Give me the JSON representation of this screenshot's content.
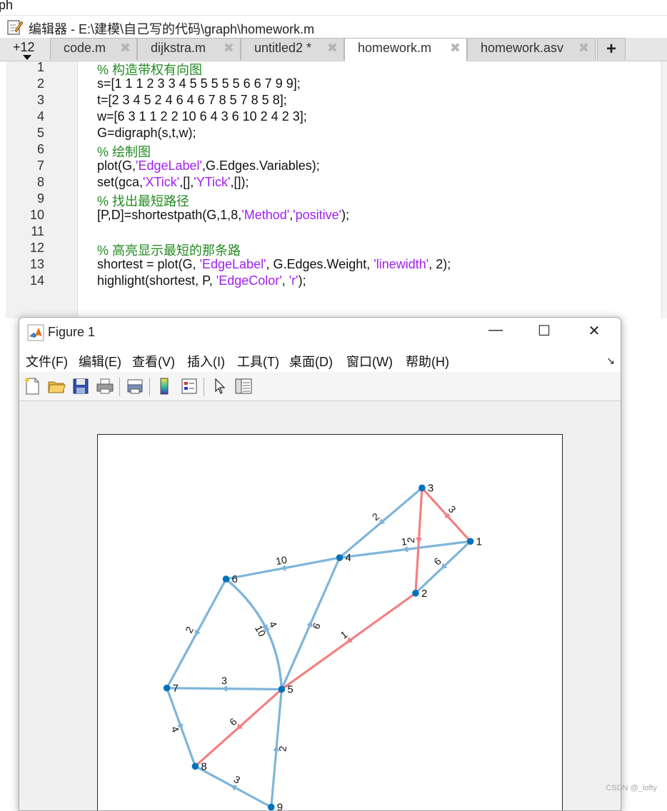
{
  "top_strip_text": "ph",
  "editor": {
    "title": "编辑器 - E:\\建模\\自己写的代码\\graph\\homework.m",
    "tab_count": "+12",
    "tabs": [
      {
        "label": "code.m"
      },
      {
        "label": "dijkstra.m"
      },
      {
        "label": "untitled2 *"
      },
      {
        "label": "homework.m"
      },
      {
        "label": "homework.asv"
      }
    ],
    "add_tab": "+",
    "close_glyph": "✖",
    "lines": [
      {
        "n": "1",
        "parts": [
          {
            "t": "% 构造带权有向图",
            "c": "cmt"
          }
        ]
      },
      {
        "n": "2",
        "parts": [
          {
            "t": "s=[1 1 1 2 3 3 4 5 5 5 5 5 6 6 7 9 9];",
            "c": ""
          }
        ]
      },
      {
        "n": "3",
        "parts": [
          {
            "t": "t=[2 3 4 5 2 4 6 4 6 7 8 5 7 8 5 8];",
            "c": ""
          }
        ]
      },
      {
        "n": "4",
        "parts": [
          {
            "t": "w=[6 3 1 1 2 2 10 6 4 3 6 10 2 4 2 3];",
            "c": ""
          }
        ]
      },
      {
        "n": "5",
        "parts": [
          {
            "t": "G=digraph(s,t,w);",
            "c": ""
          }
        ]
      },
      {
        "n": "6",
        "parts": [
          {
            "t": "% 绘制图",
            "c": "cmt"
          }
        ]
      },
      {
        "n": "7",
        "parts": [
          {
            "t": "plot(G,",
            "c": ""
          },
          {
            "t": "'EdgeLabel'",
            "c": "str"
          },
          {
            "t": ",G.Edges.Variables);",
            "c": ""
          }
        ]
      },
      {
        "n": "8",
        "parts": [
          {
            "t": "set(gca,",
            "c": ""
          },
          {
            "t": "'XTick'",
            "c": "str"
          },
          {
            "t": ",[],",
            "c": ""
          },
          {
            "t": "'YTick'",
            "c": "str"
          },
          {
            "t": ",[]);",
            "c": ""
          }
        ]
      },
      {
        "n": "9",
        "parts": [
          {
            "t": "% 找出最短路径",
            "c": "cmt"
          }
        ]
      },
      {
        "n": "10",
        "parts": [
          {
            "t": "[P,D]=shortestpath(G,1,8,",
            "c": ""
          },
          {
            "t": "'Method'",
            "c": "str"
          },
          {
            "t": ",",
            "c": ""
          },
          {
            "t": "'positive'",
            "c": "str"
          },
          {
            "t": ");",
            "c": ""
          }
        ]
      },
      {
        "n": "11",
        "parts": []
      },
      {
        "n": "12",
        "parts": [
          {
            "t": "% 高亮显示最短的那条路",
            "c": "cmt"
          }
        ]
      },
      {
        "n": "13",
        "parts": [
          {
            "t": "shortest = plot(G, ",
            "c": ""
          },
          {
            "t": "'EdgeLabel'",
            "c": "str"
          },
          {
            "t": ", G.Edges.Weight, ",
            "c": ""
          },
          {
            "t": "'linewidth'",
            "c": "str"
          },
          {
            "t": ", 2);",
            "c": ""
          }
        ]
      },
      {
        "n": "14",
        "parts": [
          {
            "t": "highlight(shortest, P, ",
            "c": ""
          },
          {
            "t": "'EdgeColor'",
            "c": "str"
          },
          {
            "t": ", ",
            "c": ""
          },
          {
            "t": "'r'",
            "c": "str"
          },
          {
            "t": ");",
            "c": ""
          }
        ]
      }
    ]
  },
  "figure": {
    "title": "Figure 1",
    "minimize": "—",
    "maximize": "☐",
    "close": "✕",
    "menus": [
      {
        "label": "文件(F)"
      },
      {
        "label": "编辑(E)"
      },
      {
        "label": "查看(V)"
      },
      {
        "label": "插入(I)"
      },
      {
        "label": "工具(T)"
      },
      {
        "label": "桌面(D)"
      },
      {
        "label": "窗口(W)"
      },
      {
        "label": "帮助(H)"
      }
    ],
    "dock_arrow": "↘",
    "toolbar_icons": [
      "new-figure-icon",
      "open-file-icon",
      "save-icon",
      "print-icon",
      "print-preview-icon",
      "colorbar-icon",
      "legend-icon",
      "pointer-icon",
      "property-inspector-icon"
    ]
  },
  "chart_data": {
    "type": "graph",
    "directed": true,
    "nodes": [
      {
        "id": "1",
        "x": 0.878,
        "y": 0.788
      },
      {
        "id": "2",
        "x": 0.741,
        "y": 0.623
      },
      {
        "id": "3",
        "x": 0.757,
        "y": 0.958
      },
      {
        "id": "4",
        "x": 0.551,
        "y": 0.736
      },
      {
        "id": "5",
        "x": 0.406,
        "y": 0.317
      },
      {
        "id": "6",
        "x": 0.267,
        "y": 0.668
      },
      {
        "id": "7",
        "x": 0.119,
        "y": 0.321
      },
      {
        "id": "8",
        "x": 0.19,
        "y": 0.072
      },
      {
        "id": "9",
        "x": 0.38,
        "y": -0.058
      }
    ],
    "edges": [
      {
        "s": "1",
        "t": "2",
        "w": "6",
        "highlighted": false
      },
      {
        "s": "1",
        "t": "3",
        "w": "3",
        "highlighted": true
      },
      {
        "s": "1",
        "t": "4",
        "w": "1",
        "highlighted": false
      },
      {
        "s": "2",
        "t": "5",
        "w": "1",
        "highlighted": true
      },
      {
        "s": "3",
        "t": "2",
        "w": "2",
        "highlighted": true
      },
      {
        "s": "3",
        "t": "4",
        "w": "2",
        "highlighted": false
      },
      {
        "s": "4",
        "t": "6",
        "w": "10",
        "highlighted": false
      },
      {
        "s": "5",
        "t": "4",
        "w": "6",
        "highlighted": false
      },
      {
        "s": "5",
        "t": "6",
        "w": "4",
        "highlighted": false
      },
      {
        "s": "5",
        "t": "7",
        "w": "3",
        "highlighted": false
      },
      {
        "s": "5",
        "t": "8",
        "w": "6",
        "highlighted": true
      },
      {
        "s": "6",
        "t": "5",
        "w": "10",
        "highlighted": false
      },
      {
        "s": "6",
        "t": "7",
        "w": "2",
        "highlighted": false
      },
      {
        "s": "7",
        "t": "8",
        "w": "4",
        "highlighted": false
      },
      {
        "s": "9",
        "t": "5",
        "w": "2",
        "highlighted": false
      },
      {
        "s": "9",
        "t": "8",
        "w": "3",
        "highlighted": false
      }
    ],
    "title": "",
    "xlabel": "",
    "ylabel": "",
    "xticks": [],
    "yticks": [],
    "colors": {
      "edge": "#7EB5DA",
      "highlight": "#F28080",
      "node": "#0072BD",
      "label": "#111111"
    }
  },
  "watermark": "CSDN @_lofty"
}
